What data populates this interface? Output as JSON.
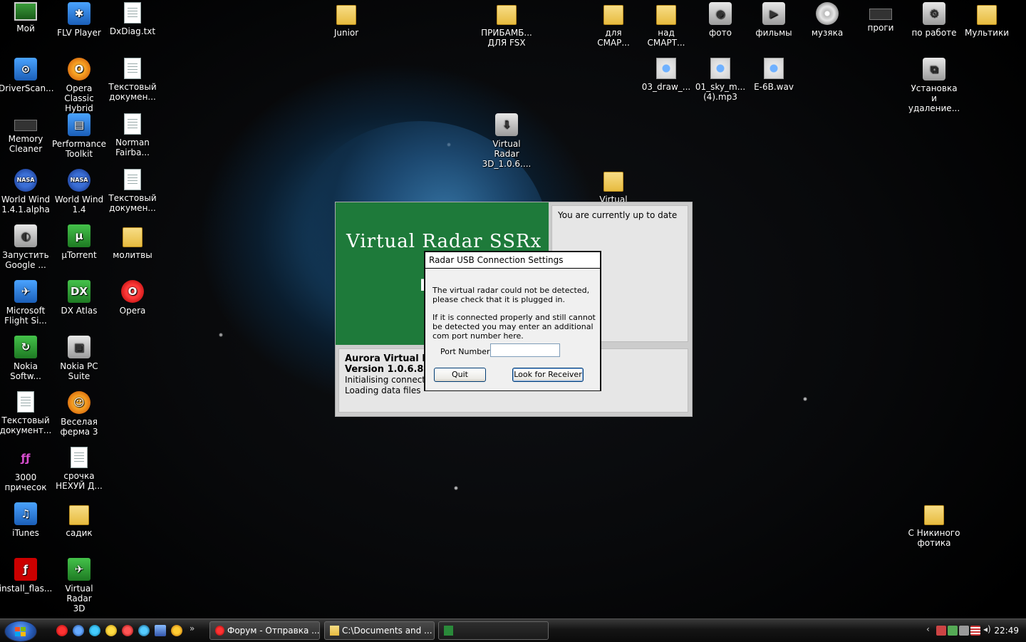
{
  "desktop": {
    "icons": [
      {
        "label": "Мой",
        "icon": "monitor-icon"
      },
      {
        "label": "FLV Player",
        "icon": "flv-player-icon"
      },
      {
        "label": "DxDiag.txt",
        "icon": "text-document-icon"
      },
      {
        "label": "DriverScan...",
        "icon": "driverscanner-icon"
      },
      {
        "label": "Opera Classic\nHybrid",
        "icon": "opera-classic-icon"
      },
      {
        "label": "Текстовый\nдокумен...",
        "icon": "text-document-icon"
      },
      {
        "label": "Memory\nCleaner",
        "icon": "memory-cleaner-icon"
      },
      {
        "label": "Performance\nToolkit",
        "icon": "performance-toolkit-icon"
      },
      {
        "label": "Norman\nFairba...",
        "icon": "text-document-icon"
      },
      {
        "label": "World Wind\n1.4.1.alpha",
        "icon": "nasa-icon"
      },
      {
        "label": "World Wind\n1.4",
        "icon": "nasa-icon"
      },
      {
        "label": "Текстовый\nдокумен...",
        "icon": "text-document-icon"
      },
      {
        "label": "Запустить\nGoogle ...",
        "icon": "google-earth-icon"
      },
      {
        "label": "µTorrent",
        "icon": "utorrent-icon"
      },
      {
        "label": "молитвы",
        "icon": "folder-icon"
      },
      {
        "label": "Microsoft\nFlight Si...",
        "icon": "flight-simulator-icon"
      },
      {
        "label": "DX Atlas",
        "icon": "dx-atlas-icon"
      },
      {
        "label": "Opera",
        "icon": "opera-icon"
      },
      {
        "label": "Nokia\nSoftw...",
        "icon": "nokia-software-icon"
      },
      {
        "label": "Nokia PC\nSuite",
        "icon": "nokia-pc-suite-icon"
      },
      {
        "label": "Текстовый\nдокумент...",
        "icon": "text-document-icon"
      },
      {
        "label": "Веселая\nферма 3",
        "icon": "farm-game-icon"
      },
      {
        "label": "3000\nпричесок",
        "icon": "hairstyles-icon"
      },
      {
        "label": "срочка\nНЕХУЙ Д...",
        "icon": "text-document-icon"
      },
      {
        "label": "iTunes",
        "icon": "itunes-icon"
      },
      {
        "label": "садик",
        "icon": "folder-icon"
      },
      {
        "label": "install_flas...",
        "icon": "flash-installer-icon"
      },
      {
        "label": "Virtual Radar\n3D",
        "icon": "virtual-radar-icon"
      },
      {
        "label": "Junior",
        "icon": "folder-icon"
      },
      {
        "label": "ПРИБАМБ...\nДЛЯ FSX",
        "icon": "folder-icon"
      },
      {
        "label": "для\nСМАР...",
        "icon": "folder-icon"
      },
      {
        "label": "над\nСМАРТ...",
        "icon": "folder-icon"
      },
      {
        "label": "фото",
        "icon": "camera-icon"
      },
      {
        "label": "фильмы",
        "icon": "video-camera-icon"
      },
      {
        "label": "музяка",
        "icon": "cd-icon"
      },
      {
        "label": "проги",
        "icon": "chip-icon"
      },
      {
        "label": "по работе",
        "icon": "settings-icon"
      },
      {
        "label": "Мультики",
        "icon": "folder-icon"
      },
      {
        "label": "03_draw_...",
        "icon": "media-file-icon"
      },
      {
        "label": "01_sky_m...\n(4).mp3",
        "icon": "media-file-icon"
      },
      {
        "label": "E-6B.wav",
        "icon": "media-file-icon"
      },
      {
        "label": "Установка и\nудаление...",
        "icon": "add-remove-programs-icon"
      },
      {
        "label": "Virtual Radar\n3D_1.0.6....",
        "icon": "installer-icon"
      },
      {
        "label": "Virtual Radar",
        "icon": "folder-icon"
      },
      {
        "label": "С Никиного\nфотика",
        "icon": "folder-icon"
      }
    ]
  },
  "app_window": {
    "banner_title": "Virtual Radar SSRx",
    "banner_fragment": "L",
    "status_text": "You are currently up to date",
    "info": {
      "product": "Aurora Virtual Rad",
      "version": "Version 1.0.6.8",
      "line1": "Initialising connection",
      "line2": "Loading data files"
    }
  },
  "dialog": {
    "title": "Radar USB Connection Settings",
    "message1": "The virtual radar could not be detected, please check that it is plugged in.",
    "message2": "If it is connected properly and still cannot be detected you may enter an additional com port number here.",
    "port_label": "Port Number:",
    "port_value": "",
    "quit_label": "Quit",
    "look_label": "Look for Receiver"
  },
  "taskbar": {
    "quicklaunch_more": "»",
    "tasks": [
      {
        "label": "Форум - Отправка ...",
        "icon": "opera-icon"
      },
      {
        "label": "C:\\Documents and ...",
        "icon": "folder-icon"
      },
      {
        "label": "",
        "icon": "virtual-radar-icon"
      }
    ],
    "tray_chevron": "‹",
    "clock": "22:49"
  },
  "colors": {
    "banner_green": "#1e7a3a",
    "panel_grey": "#e6e6e6",
    "dialog_bg": "#f0f0f0"
  }
}
